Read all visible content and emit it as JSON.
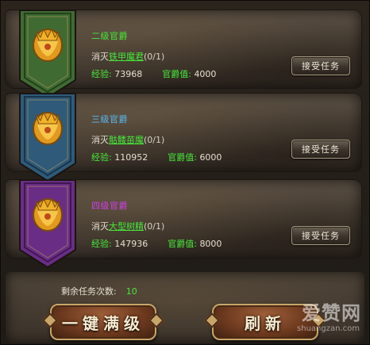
{
  "tasks": [
    {
      "rank_title": "二级官爵",
      "title_color": "#46e83a",
      "banner_color": "#3f6b33",
      "banner_dark": "#243f1c",
      "objective_prefix": "消灭",
      "target": "铁甲魔君",
      "count": "(0/1)",
      "exp_label": "经验:",
      "exp_value": "73968",
      "rank_label": "官爵值:",
      "rank_value": "4000",
      "accept_label": "接受任务"
    },
    {
      "rank_title": "三级官爵",
      "title_color": "#5ab8f0",
      "banner_color": "#2f5a7a",
      "banner_dark": "#1a3448",
      "objective_prefix": "消灭",
      "target": "骷髅苗魔",
      "count": "(0/1)",
      "exp_label": "经验:",
      "exp_value": "110952",
      "rank_label": "官爵值:",
      "rank_value": "6000",
      "accept_label": "接受任务"
    },
    {
      "rank_title": "四级官爵",
      "title_color": "#d040e8",
      "banner_color": "#6a2d86",
      "banner_dark": "#3e1852",
      "objective_prefix": "消灭",
      "target": "大型树精",
      "count": "(0/1)",
      "exp_label": "经验:",
      "exp_value": "147936",
      "rank_label": "官爵值:",
      "rank_value": "8000",
      "accept_label": "接受任务"
    }
  ],
  "footer": {
    "remaining_label": "剩余任务次数:",
    "remaining_value": "10",
    "max_level_label": "一键满级",
    "refresh_label": "刷新"
  },
  "watermark": {
    "brand": "爱赞网",
    "url": "shuangzan.com"
  }
}
